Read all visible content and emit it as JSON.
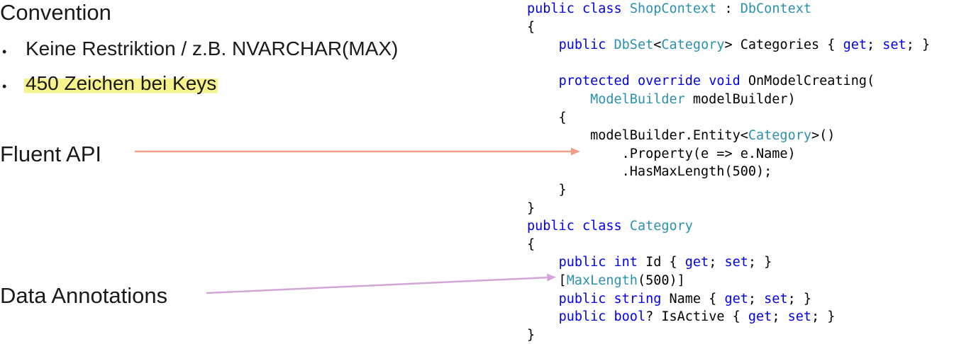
{
  "left": {
    "convention_heading": "Convention",
    "bullets": [
      {
        "text": "Keine Restriktion / z.B. NVARCHAR(MAX)",
        "highlighted": false
      },
      {
        "text": "450 Zeichen bei Keys",
        "highlighted": true
      }
    ],
    "bullet_glyph": "•",
    "fluent_heading": "Fluent API",
    "annotations_heading": "Data Annotations"
  },
  "colors": {
    "keyword": "#0000ee",
    "type": "#2b91af",
    "highlight": "#f7f38c",
    "fluent_arrow": "#f0a08a",
    "annotations_arrow": "#d4a6d8"
  },
  "code": {
    "lines": [
      [
        [
          "kw",
          "public"
        ],
        [
          "p",
          " "
        ],
        [
          "kw",
          "class"
        ],
        [
          "p",
          " "
        ],
        [
          "ty",
          "ShopContext"
        ],
        [
          "p",
          " : "
        ],
        [
          "ty",
          "DbContext"
        ]
      ],
      [
        [
          "p",
          "{"
        ]
      ],
      [
        [
          "p",
          "    "
        ],
        [
          "kw",
          "public"
        ],
        [
          "p",
          " "
        ],
        [
          "ty",
          "DbSet"
        ],
        [
          "p",
          "<"
        ],
        [
          "ty",
          "Category"
        ],
        [
          "p",
          "> Categories { "
        ],
        [
          "kw",
          "get"
        ],
        [
          "p",
          "; "
        ],
        [
          "kw",
          "set"
        ],
        [
          "p",
          "; }"
        ]
      ],
      [
        [
          "p",
          ""
        ]
      ],
      [
        [
          "p",
          "    "
        ],
        [
          "kw",
          "protected"
        ],
        [
          "p",
          " "
        ],
        [
          "kw",
          "override"
        ],
        [
          "p",
          " "
        ],
        [
          "kw",
          "void"
        ],
        [
          "p",
          " OnModelCreating("
        ]
      ],
      [
        [
          "p",
          "        "
        ],
        [
          "ty",
          "ModelBuilder"
        ],
        [
          "p",
          " modelBuilder)"
        ]
      ],
      [
        [
          "p",
          "    {"
        ]
      ],
      [
        [
          "p",
          "        modelBuilder.Entity<"
        ],
        [
          "ty",
          "Category"
        ],
        [
          "p",
          ">()"
        ]
      ],
      [
        [
          "p",
          "            .Property(e => e.Name)"
        ]
      ],
      [
        [
          "p",
          "            .HasMaxLength(500);"
        ]
      ],
      [
        [
          "p",
          "    }"
        ]
      ],
      [
        [
          "p",
          "}"
        ]
      ],
      [
        [
          "kw",
          "public"
        ],
        [
          "p",
          " "
        ],
        [
          "kw",
          "class"
        ],
        [
          "p",
          " "
        ],
        [
          "ty",
          "Category"
        ]
      ],
      [
        [
          "p",
          "{"
        ]
      ],
      [
        [
          "p",
          "    "
        ],
        [
          "kw",
          "public"
        ],
        [
          "p",
          " "
        ],
        [
          "kw",
          "int"
        ],
        [
          "p",
          " Id { "
        ],
        [
          "kw",
          "get"
        ],
        [
          "p",
          "; "
        ],
        [
          "kw",
          "set"
        ],
        [
          "p",
          "; }"
        ]
      ],
      [
        [
          "p",
          "    ["
        ],
        [
          "ty",
          "MaxLength"
        ],
        [
          "p",
          "(500)]"
        ]
      ],
      [
        [
          "p",
          "    "
        ],
        [
          "kw",
          "public"
        ],
        [
          "p",
          " "
        ],
        [
          "kw",
          "string"
        ],
        [
          "p",
          " Name { "
        ],
        [
          "kw",
          "get"
        ],
        [
          "p",
          "; "
        ],
        [
          "kw",
          "set"
        ],
        [
          "p",
          "; }"
        ]
      ],
      [
        [
          "p",
          "    "
        ],
        [
          "kw",
          "public"
        ],
        [
          "p",
          " "
        ],
        [
          "kw",
          "bool"
        ],
        [
          "p",
          "? IsActive { "
        ],
        [
          "kw",
          "get"
        ],
        [
          "p",
          "; "
        ],
        [
          "kw",
          "set"
        ],
        [
          "p",
          "; }"
        ]
      ],
      [
        [
          "p",
          "}"
        ]
      ]
    ]
  }
}
